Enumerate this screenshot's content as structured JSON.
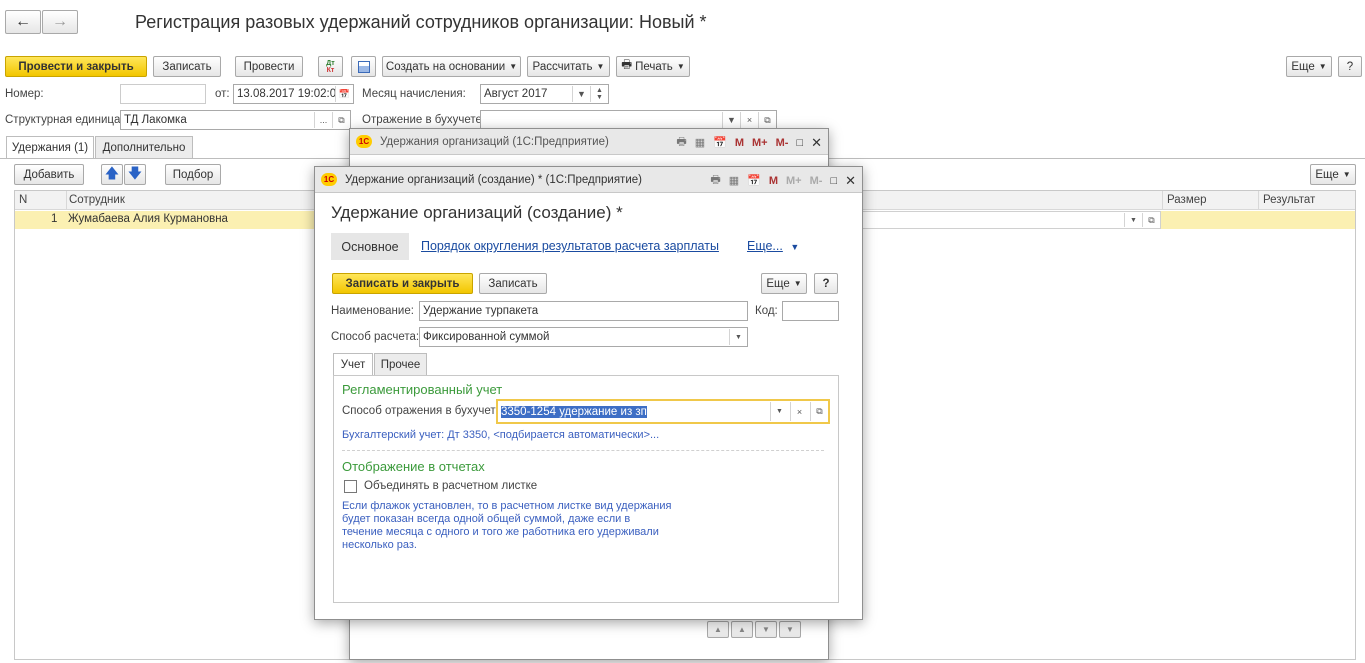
{
  "main": {
    "title": "Регистрация разовых удержаний сотрудников организации: Новый *",
    "toolbar": {
      "post_close": "Провести и закрыть",
      "save": "Записать",
      "post": "Провести",
      "dt_kt": "Дт Кт",
      "create_based": "Создать на основании",
      "calculate": "Рассчитать",
      "print": "Печать",
      "more": "Еще"
    },
    "fields": {
      "number_label": "Номер:",
      "number_value": "",
      "from_label": "от:",
      "date_value": "13.08.2017 19:02:0",
      "month_label": "Месяц начисления:",
      "month_value": "Август 2017",
      "unit_label": "Структурная единица:",
      "unit_value": "ТД Лакомка",
      "acc_label": "Отражение в бухучете:",
      "acc_value": ""
    },
    "tabs": [
      "Удержания (1)",
      "Дополнительно"
    ],
    "table_toolbar": {
      "add": "Добавить",
      "pick": "Подбор",
      "more": "Еще"
    },
    "columns": {
      "n": "N",
      "employee": "Сотрудник",
      "size": "Размер",
      "result": "Результат"
    },
    "rows": [
      {
        "n": "1",
        "employee": "Жумабаева Алия Курмановна"
      }
    ]
  },
  "back_window": {
    "title": "Удержания организаций  (1С:Предприятие)"
  },
  "dialog": {
    "title_bar": "Удержание организаций (создание) *  (1С:Предприятие)",
    "heading": "Удержание организаций (создание) *",
    "nav": {
      "main": "Основное",
      "rounding": "Порядок округления результатов расчета зарплаты",
      "more": "Еще..."
    },
    "save_close": "Записать и закрыть",
    "save": "Записать",
    "more": "Еще",
    "help": "?",
    "name_label": "Наименование:",
    "name_value": "Удержание турпакета",
    "code_label": "Код:",
    "code_value": "",
    "calc_label": "Способ расчета:",
    "calc_value": "Фиксированной суммой",
    "tabs": [
      "Учет",
      "Прочее"
    ],
    "section1": "Регламентированный учет",
    "acc_method_label": "Способ отражения в бухучете:",
    "acc_method_value": "3350-1254 удержание из зп",
    "acc_info": "Бухгалтерский учет: Дт 3350, <подбирается автоматически>...",
    "section2": "Отображение в отчетах",
    "checkbox_label": "Объединять в расчетном листке",
    "hint": "Если флажок установлен, то в расчетном листке вид удержания будет показан всегда одной общей суммой, даже если в течение месяца с одного и того же работника его удерживали несколько раз."
  },
  "icons": {
    "back": "arrow-left-icon",
    "forward": "arrow-right-icon",
    "print": "printer-icon",
    "calendar": "calendar-icon",
    "up": "arrow-up-icon",
    "down": "arrow-down-icon"
  }
}
